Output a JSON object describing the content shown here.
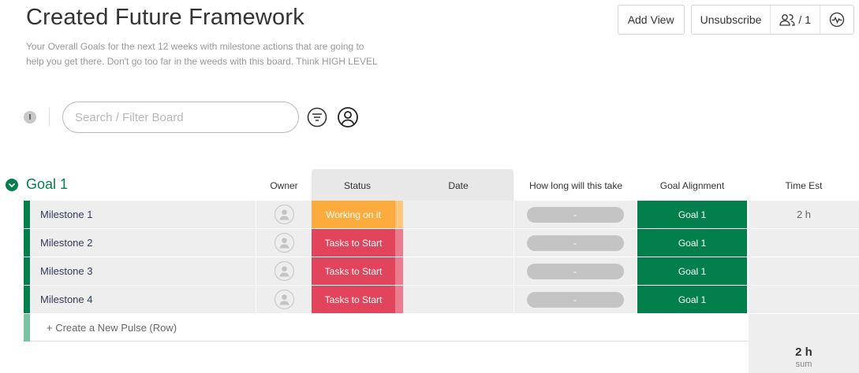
{
  "board": {
    "title": "Created Future Framework",
    "description": "Your Overall Goals for the next 12 weeks with milestone actions that are going to help you get there. Don't go too far in the weeds with this board. Think HIGH LEVEL"
  },
  "header_actions": {
    "add_view": "Add View",
    "unsubscribe": "Unsubscribe",
    "members_count": "/ 1",
    "members_icon": "people-icon",
    "activity_icon": "activity-icon"
  },
  "toolbar": {
    "info_glyph": "I",
    "search_placeholder": "Search / Filter Board",
    "filter_icon": "filter-icon",
    "person_icon": "person-filter-icon"
  },
  "group": {
    "title": "Goal 1",
    "color": "#037f4c"
  },
  "columns": {
    "owner": "Owner",
    "status": "Status",
    "date": "Date",
    "how_long": "How long will this take",
    "goal_alignment": "Goal Alignment",
    "time_est": "Time Est"
  },
  "rows": [
    {
      "name": "Milestone 1",
      "status": "Working on it",
      "status_color": "#fdab3d",
      "status_tail_color": "#fec67a",
      "date": "",
      "how_long": "-",
      "goal_alignment": "Goal 1",
      "time_est": "2 h"
    },
    {
      "name": "Milestone 2",
      "status": "Tasks to Start",
      "status_color": "#e2445c",
      "status_tail_color": "#eb7c8d",
      "date": "",
      "how_long": "-",
      "goal_alignment": "Goal 1",
      "time_est": ""
    },
    {
      "name": "Milestone 3",
      "status": "Tasks to Start",
      "status_color": "#e2445c",
      "status_tail_color": "#eb7c8d",
      "date": "",
      "how_long": "-",
      "goal_alignment": "Goal 1",
      "time_est": ""
    },
    {
      "name": "Milestone 4",
      "status": "Tasks to Start",
      "status_color": "#e2445c",
      "status_tail_color": "#eb7c8d",
      "date": "",
      "how_long": "-",
      "goal_alignment": "Goal 1",
      "time_est": ""
    }
  ],
  "new_row_label": "+ Create a New Pulse (Row)",
  "summary": {
    "time_est_total": "2 h",
    "time_est_label": "sum"
  },
  "colors": {
    "goal_green": "#037f4c",
    "working_orange": "#fdab3d",
    "stuck_red": "#e2445c",
    "pill_gray": "#c4c4c4"
  }
}
